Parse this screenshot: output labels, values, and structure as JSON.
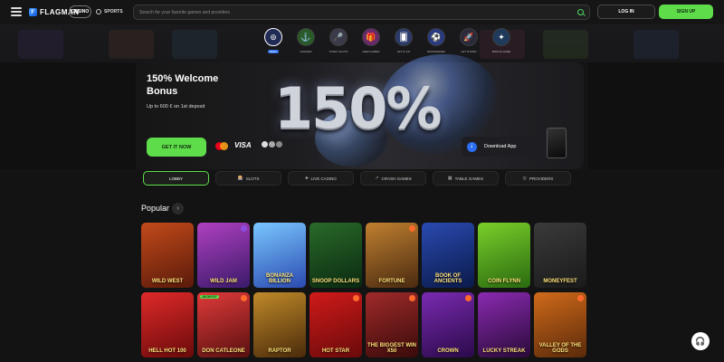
{
  "header": {
    "logo_text": "FLAGMAN",
    "casino_label": "CASINO",
    "sports_label": "SPORTS",
    "search_placeholder": "Search for your favorite games and providers",
    "login_label": "LOG IN",
    "signup_label": "SIGN UP"
  },
  "categories": [
    {
      "label": "MENU",
      "icon": "menu-icon",
      "glyph": "⊚",
      "color": "#1f2a55"
    },
    {
      "label": "HOOKED",
      "icon": "hook-icon",
      "glyph": "⚓",
      "color": "#2a5a2a"
    },
    {
      "label": "TODAY SLOTS",
      "icon": "mic-icon",
      "glyph": "🎤",
      "color": "#3a3a4a"
    },
    {
      "label": "NEW GAMES",
      "icon": "gift-icon",
      "glyph": "🎁",
      "color": "#6a2a6a"
    },
    {
      "label": "LET IT GO",
      "icon": "card-icon",
      "glyph": "🂠",
      "color": "#2a3a6a"
    },
    {
      "label": "BOOKMAKER",
      "icon": "ball-icon",
      "glyph": "⚽",
      "color": "#2a3a80"
    },
    {
      "label": "LET IT RAIN",
      "icon": "rocket-icon",
      "glyph": "🚀",
      "color": "#2a2a3a"
    },
    {
      "label": "BONUS GAME",
      "icon": "bonus-icon",
      "glyph": "✦",
      "color": "#1f3a5a"
    }
  ],
  "hero": {
    "title": "150% Welcome Bonus",
    "subtitle": "Up to 600 € on 1st deposit",
    "big_text": "150%",
    "cta_label": "GET IT NOW",
    "visa_label": "VISA",
    "download_label": "Download App"
  },
  "tabs": [
    {
      "label": "LOBBY",
      "icon": "lobby-icon",
      "glyph": "",
      "active": true
    },
    {
      "label": "SLOTS",
      "icon": "slots-icon",
      "glyph": "🎰",
      "active": false
    },
    {
      "label": "LIVE CASINO",
      "icon": "live-icon",
      "glyph": "♣",
      "active": false
    },
    {
      "label": "CRASH GAMES",
      "icon": "crash-icon",
      "glyph": "↗",
      "active": false
    },
    {
      "label": "TABLE GAMES",
      "icon": "table-icon",
      "glyph": "▦",
      "active": false
    },
    {
      "label": "PROVIDERS",
      "icon": "providers-icon",
      "glyph": "◎",
      "active": false
    }
  ],
  "popular_title": "Popular",
  "games_row1": [
    {
      "name": "WILD WEST",
      "bg": "linear-gradient(160deg,#c24a1a,#5a1a0a)",
      "badge": ""
    },
    {
      "name": "WILD JAM",
      "bg": "linear-gradient(160deg,#b040c0,#3a1a6a)",
      "badge": "purple"
    },
    {
      "name": "BONANZA BILLION",
      "bg": "linear-gradient(160deg,#7ac7ff,#2a4ab0)",
      "badge": ""
    },
    {
      "name": "SNOOP DOLLARS",
      "bg": "linear-gradient(160deg,#2a6a2a,#0a2a10)",
      "badge": ""
    },
    {
      "name": "FORTUNE",
      "bg": "linear-gradient(160deg,#c08030,#4a2a10)",
      "badge": "orange"
    },
    {
      "name": "BOOK OF ANCIENTS",
      "bg": "linear-gradient(160deg,#2a4ab0,#0a1a4a)",
      "badge": ""
    },
    {
      "name": "COIN FLYNN",
      "bg": "linear-gradient(160deg,#7acf2a,#2a6a10)",
      "badge": ""
    },
    {
      "name": "MONEYFEST",
      "bg": "linear-gradient(160deg,#3a3a3a,#1a1a1a)",
      "badge": ""
    }
  ],
  "games_row2": [
    {
      "name": "HELL HOT 100",
      "bg": "linear-gradient(160deg,#e02a2a,#6a0a0a)",
      "badge": "",
      "sticker": ""
    },
    {
      "name": "DON CATLEONE",
      "bg": "linear-gradient(160deg,#e03a3a,#5a1010)",
      "badge": "orange",
      "sticker": "JACKPOT"
    },
    {
      "name": "RAPTOR",
      "bg": "linear-gradient(160deg,#c08a2a,#4a2a0a)",
      "badge": "",
      "sticker": ""
    },
    {
      "name": "HOT STAR",
      "bg": "linear-gradient(160deg,#d01a1a,#6a0a0a)",
      "badge": "orange",
      "sticker": ""
    },
    {
      "name": "THE BIGGEST WIN X50",
      "bg": "linear-gradient(160deg,#a02a2a,#3a0a0a)",
      "badge": "orange",
      "sticker": ""
    },
    {
      "name": "CROWN",
      "bg": "linear-gradient(160deg,#7a2ab0,#2a0a4a)",
      "badge": "orange",
      "sticker": ""
    },
    {
      "name": "LUCKY STREAK",
      "bg": "linear-gradient(160deg,#8a2ab0,#2a0a3a)",
      "badge": "",
      "sticker": ""
    },
    {
      "name": "VALLEY OF THE GODS",
      "bg": "linear-gradient(160deg,#d06a1a,#5a2a0a)",
      "badge": "orange",
      "sticker": ""
    }
  ],
  "colors": {
    "accent_green": "#5edc4a",
    "accent_blue": "#2b6df0",
    "badge_orange": "#ff6a2c"
  }
}
